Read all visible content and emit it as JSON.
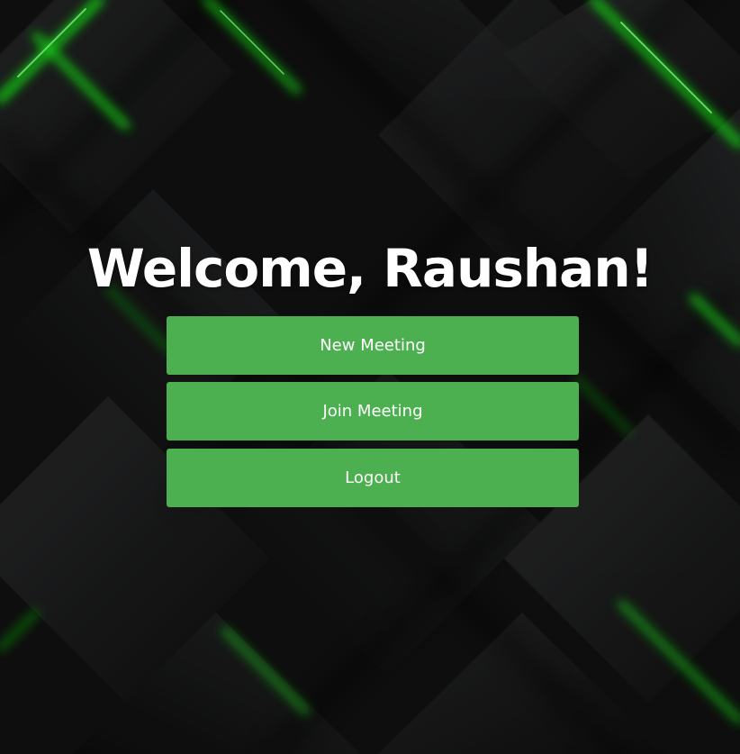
{
  "welcome": {
    "title": "Welcome, Raushan!"
  },
  "actions": {
    "new_meeting_label": "New Meeting",
    "join_meeting_label": "Join Meeting",
    "logout_label": "Logout"
  },
  "colors": {
    "button_bg": "#4caf50",
    "button_text": "#ffffff",
    "title_text": "#ffffff",
    "background": "#111111",
    "accent_glow": "#16e016"
  }
}
